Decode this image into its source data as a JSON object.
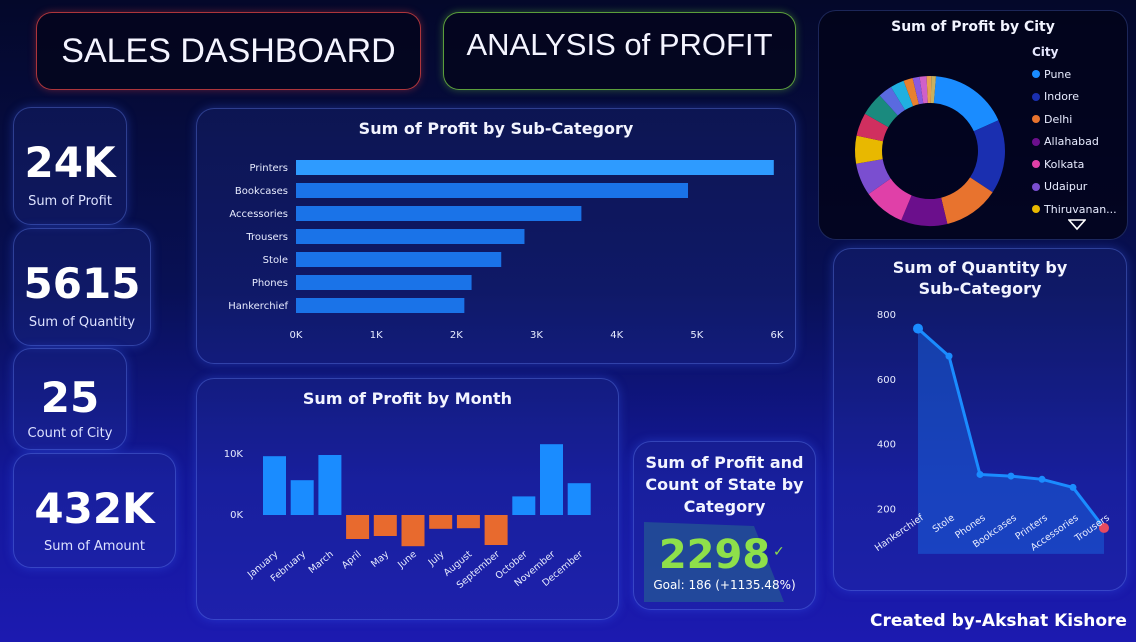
{
  "header": {
    "title": "SALES DASHBOARD",
    "subtitle": "ANALYSIS of PROFIT"
  },
  "kpis": [
    {
      "value": "24K",
      "label": "Sum of Profit"
    },
    {
      "value": "5615",
      "label": "Sum of Quantity"
    },
    {
      "value": "25",
      "label": "Count of City"
    },
    {
      "value": "432K",
      "label": "Sum of Amount"
    }
  ],
  "footer": {
    "credit": "Created by-Akshat Kishore"
  },
  "gauge": {
    "title": "Sum of Profit and Count of State by Category",
    "value": "2298",
    "goal": "Goal: 186 (+1135.48%)",
    "check": "✓"
  },
  "colors": {
    "bar_blue": "#1a8cff",
    "bar_blue_sub": "#1a73e8",
    "negative_orange": "#e86a2e",
    "line_blue": "#1a8cff",
    "end_marker": "#e84a5f"
  },
  "icons": {
    "legend_more": "caret-down-icon",
    "gauge_check": "check-icon"
  },
  "chart_data": [
    {
      "type": "bar",
      "orientation": "horizontal",
      "title": "Sum of Profit by Sub-Category",
      "categories": [
        "Printers",
        "Bookcases",
        "Accessories",
        "Trousers",
        "Stole",
        "Phones",
        "Hankerchief"
      ],
      "values": [
        5960,
        4890,
        3560,
        2850,
        2560,
        2190,
        2100
      ],
      "xlim": [
        0,
        6000
      ],
      "xticks": [
        "0K",
        "1K",
        "2K",
        "3K",
        "4K",
        "5K",
        "6K"
      ],
      "grid": false
    },
    {
      "type": "bar",
      "title": "Sum of Profit by Month",
      "categories": [
        "January",
        "February",
        "March",
        "April",
        "May",
        "June",
        "July",
        "August",
        "September",
        "October",
        "November",
        "December"
      ],
      "values": [
        9800,
        5800,
        10000,
        -4000,
        -3500,
        -5200,
        -2300,
        -2200,
        -5000,
        3100,
        11800,
        5300
      ],
      "ylim": [
        -7000,
        13000
      ],
      "yticks": [
        "10K",
        "0K"
      ],
      "grid": false
    },
    {
      "type": "pie",
      "donut": true,
      "title": "Sum of Profit by City",
      "legend_title": "City",
      "legend_position": "right",
      "categories": [
        "Pune",
        "Indore",
        "Delhi",
        "Allahabad",
        "Kolkata",
        "Udaipur",
        "Thiruvanan..."
      ],
      "values": [
        17,
        16,
        12,
        10,
        9,
        7,
        6,
        5,
        5,
        3,
        3,
        2,
        1.5,
        1.5,
        1,
        1
      ],
      "colors": [
        "#1a8cff",
        "#1a2fb0",
        "#e8732e",
        "#6b0f8c",
        "#e040a8",
        "#7a4ed0",
        "#e8b800",
        "#d02f5f",
        "#1a8a7e",
        "#5a6ae0",
        "#20b0e0",
        "#e8802e",
        "#8a5ae0",
        "#d060c8",
        "#e8a050",
        "#c8b060"
      ]
    },
    {
      "type": "area",
      "title": "Sum of Quantity by Sub-Category",
      "categories": [
        "Hankerchief",
        "Stole",
        "Phones",
        "Bookcases",
        "Printers",
        "Accessories",
        "Trousers"
      ],
      "values": [
        755,
        670,
        305,
        300,
        290,
        265,
        140
      ],
      "ylim": [
        100,
        820
      ],
      "yticks": [
        800,
        600,
        400,
        200
      ],
      "grid": false
    }
  ]
}
